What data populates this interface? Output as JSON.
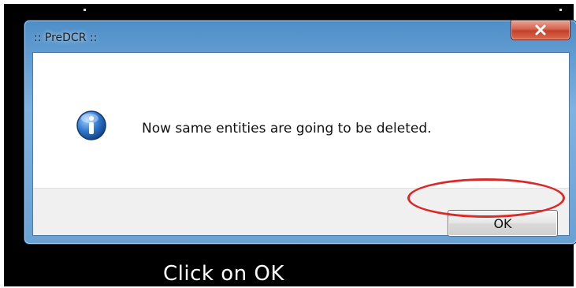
{
  "dialog": {
    "title": ":: PreDCR ::",
    "message": "Now same entities are going to be deleted.",
    "ok_label": "OK",
    "close_icon": "close-icon",
    "info_icon": "info-icon"
  },
  "annotation": {
    "caption": "Click on OK",
    "highlight_color": "#d92a2a"
  },
  "colors": {
    "title_bar": "#6aa1d3",
    "close_button": "#c3402a",
    "background": "#000000"
  }
}
